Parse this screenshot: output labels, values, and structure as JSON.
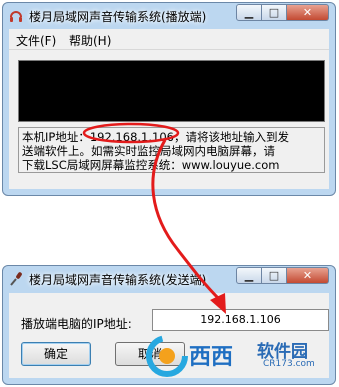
{
  "player_window": {
    "title": "楼月局域网声音传输系统(播放端)",
    "menu": [
      "文件(F)",
      "帮助(H)"
    ],
    "info_lines": [
      "本机IP地址：192.168.1.106，请将该地址输入到发",
      "送端软件上。如需实时监控局域网内电脑屏幕，请",
      "下载LSC局域网屏幕监控系统：www.louyue.com"
    ],
    "highlighted_ip": "192.168.1.106"
  },
  "sender_window": {
    "title": "楼月局域网声音传输系统(发送端)",
    "ip_label": "播放端电脑的IP地址:",
    "ip_value": "192.168.1.106",
    "ok_label": "确定",
    "cancel_label": "取消"
  },
  "watermark": {
    "brand_text": "西西",
    "brand_text2": "软件园",
    "domain_text": "CR173.com"
  },
  "colors": {
    "window_frame": "#bcd7f0",
    "annotation_red": "#e31b1b",
    "watermark_blue": "#1f6fc2"
  }
}
